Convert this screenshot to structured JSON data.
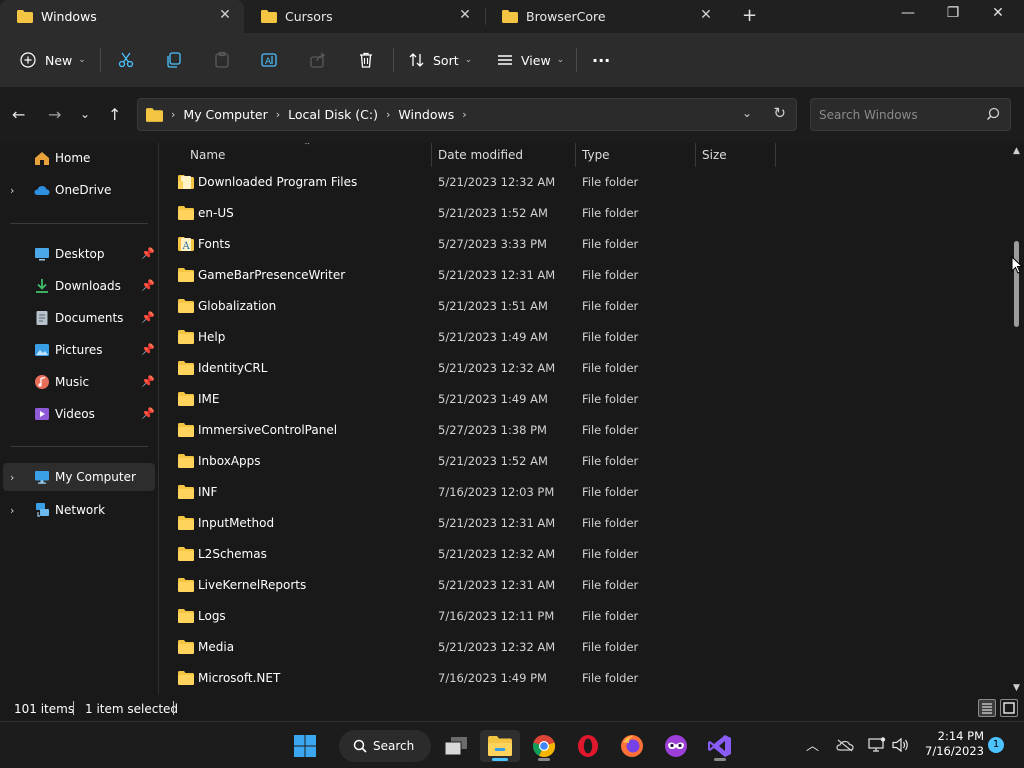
{
  "tabs": [
    {
      "label": "Windows",
      "active": true
    },
    {
      "label": "Cursors",
      "active": false
    },
    {
      "label": "BrowserCore",
      "active": false
    }
  ],
  "window_controls": {
    "minimize": "—",
    "maximize": "❐",
    "close": "✕",
    "new_tab": "+"
  },
  "commandbar": {
    "new_label": "New",
    "sort_label": "Sort",
    "view_label": "View",
    "more_label": "···"
  },
  "address": {
    "breadcrumbs": [
      "My Computer",
      "Local Disk (C:)",
      "Windows"
    ]
  },
  "search": {
    "placeholder": "Search Windows"
  },
  "navpane": {
    "home": "Home",
    "onedrive": "OneDrive",
    "quick_access": [
      {
        "label": "Desktop",
        "icon": "desktop-icon",
        "color": "#4aa8e8"
      },
      {
        "label": "Downloads",
        "icon": "download-icon",
        "color": "#3fbf6b"
      },
      {
        "label": "Documents",
        "icon": "document-icon",
        "color": "#b8c2cc"
      },
      {
        "label": "Pictures",
        "icon": "pictures-icon",
        "color": "#3a9ee6"
      },
      {
        "label": "Music",
        "icon": "music-icon",
        "color": "#e86e5a"
      },
      {
        "label": "Videos",
        "icon": "videos-icon",
        "color": "#8e5ad8"
      }
    ],
    "my_computer": "My Computer",
    "network": "Network"
  },
  "columns": {
    "name": "Name",
    "date": "Date modified",
    "type": "Type",
    "size": "Size"
  },
  "files": [
    {
      "name": "Downloaded Program Files",
      "date": "5/21/2023 12:32 AM",
      "type": "File folder",
      "icon": "special-folder-icon"
    },
    {
      "name": "en-US",
      "date": "5/21/2023 1:52 AM",
      "type": "File folder",
      "icon": "folder-icon"
    },
    {
      "name": "Fonts",
      "date": "5/27/2023 3:33 PM",
      "type": "File folder",
      "icon": "fonts-folder-icon"
    },
    {
      "name": "GameBarPresenceWriter",
      "date": "5/21/2023 12:31 AM",
      "type": "File folder",
      "icon": "folder-icon"
    },
    {
      "name": "Globalization",
      "date": "5/21/2023 1:51 AM",
      "type": "File folder",
      "icon": "folder-icon"
    },
    {
      "name": "Help",
      "date": "5/21/2023 1:49 AM",
      "type": "File folder",
      "icon": "folder-icon"
    },
    {
      "name": "IdentityCRL",
      "date": "5/21/2023 12:32 AM",
      "type": "File folder",
      "icon": "folder-icon"
    },
    {
      "name": "IME",
      "date": "5/21/2023 1:49 AM",
      "type": "File folder",
      "icon": "folder-icon"
    },
    {
      "name": "ImmersiveControlPanel",
      "date": "5/27/2023 1:38 PM",
      "type": "File folder",
      "icon": "folder-icon"
    },
    {
      "name": "InboxApps",
      "date": "5/21/2023 1:52 AM",
      "type": "File folder",
      "icon": "folder-icon"
    },
    {
      "name": "INF",
      "date": "7/16/2023 12:03 PM",
      "type": "File folder",
      "icon": "folder-icon"
    },
    {
      "name": "InputMethod",
      "date": "5/21/2023 12:31 AM",
      "type": "File folder",
      "icon": "folder-icon"
    },
    {
      "name": "L2Schemas",
      "date": "5/21/2023 12:32 AM",
      "type": "File folder",
      "icon": "folder-icon"
    },
    {
      "name": "LiveKernelReports",
      "date": "5/21/2023 12:31 AM",
      "type": "File folder",
      "icon": "folder-icon"
    },
    {
      "name": "Logs",
      "date": "7/16/2023 12:11 PM",
      "type": "File folder",
      "icon": "folder-icon"
    },
    {
      "name": "Media",
      "date": "5/21/2023 12:32 AM",
      "type": "File folder",
      "icon": "folder-icon"
    },
    {
      "name": "Microsoft.NET",
      "date": "7/16/2023 1:49 PM",
      "type": "File folder",
      "icon": "folder-icon"
    }
  ],
  "status": {
    "count": "101 items",
    "selected": "1 item selected"
  },
  "taskbar": {
    "search_label": "Search",
    "time": "2:14 PM",
    "date": "7/16/2023",
    "notification_count": "1"
  },
  "colors": {
    "folder": "#f4c542",
    "accent": "#4cc2ff",
    "background": "#191919"
  }
}
